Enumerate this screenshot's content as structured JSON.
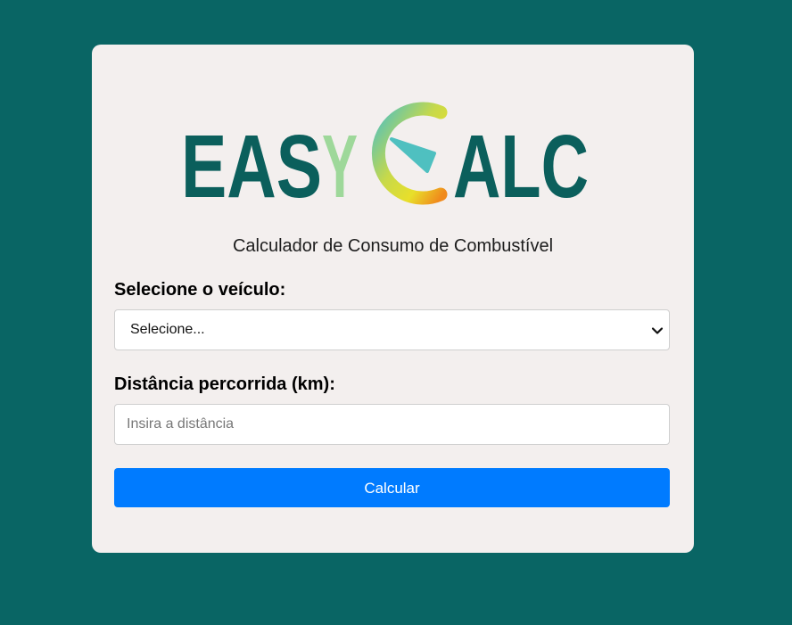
{
  "logo": {
    "text_left": "EASY",
    "text_right": "ALC",
    "colors": {
      "dark": "#0b5f5c",
      "light_green": "#9ed89a",
      "gauge_teal": "#4fc0c0",
      "gauge_yellow": "#e8df2a",
      "gauge_orange": "#f08a1c"
    }
  },
  "subtitle": "Calculador de Consumo de Combustível",
  "vehicle": {
    "label": "Selecione o veículo:",
    "selected": "Selecione...",
    "icon": "chevron-down-icon"
  },
  "distance": {
    "label": "Distância percorrida (km):",
    "value": "",
    "placeholder": "Insira a distância"
  },
  "calculate_button": {
    "label": "Calcular",
    "color": "#007bff"
  },
  "colors": {
    "background": "#096564",
    "card": "#f3efee"
  }
}
